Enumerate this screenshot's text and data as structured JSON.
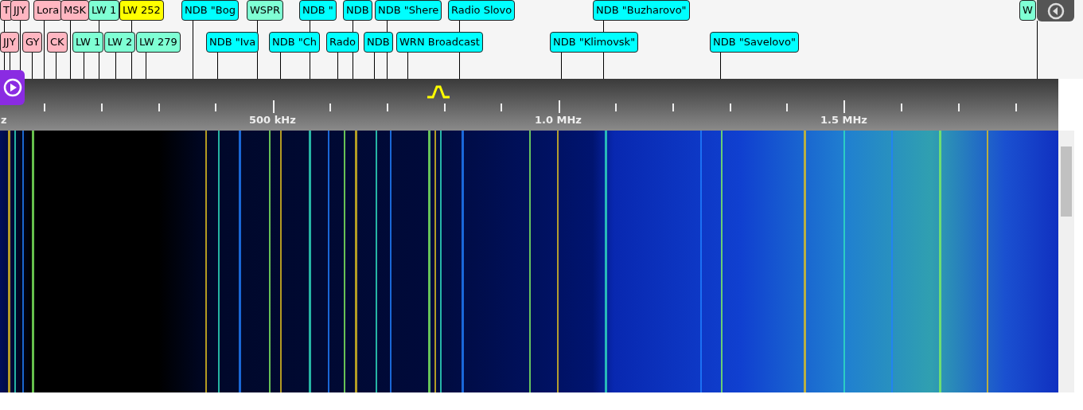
{
  "bookmarks": {
    "upper_row": [
      {
        "label": "T",
        "color": "#ffb6c1"
      },
      {
        "label": "JJY",
        "color": "#ffb6c1"
      },
      {
        "label": "Lora",
        "color": "#ffb6c1"
      },
      {
        "label": "MSK",
        "color": "#ffb6c1"
      },
      {
        "label": "LW 1",
        "color": "#7fffd4"
      },
      {
        "label": "LW 252",
        "color": "#ffff00"
      },
      {
        "label": "NDB \"Bog",
        "color": "#00ffff"
      },
      {
        "label": "WSPR",
        "color": "#7fffd4"
      },
      {
        "label": "NDB \"",
        "color": "#00ffff"
      },
      {
        "label": "NDB",
        "color": "#00ffff"
      },
      {
        "label": "NDB \"Shere",
        "color": "#00ffff"
      },
      {
        "label": "Radio Slovo",
        "color": "#00ffff"
      },
      {
        "label": "NDB \"Buzharovo\"",
        "color": "#00ffff"
      },
      {
        "label": "W",
        "color": "#7fffd4"
      }
    ],
    "lower_row": [
      {
        "label": "JJY",
        "color": "#ffb6c1"
      },
      {
        "label": "GY",
        "color": "#ffb6c1"
      },
      {
        "label": "CK",
        "color": "#ffb6c1"
      },
      {
        "label": "LW 1",
        "color": "#7fffd4"
      },
      {
        "label": "LW 2",
        "color": "#7fffd4"
      },
      {
        "label": "LW 279",
        "color": "#7fffd4"
      },
      {
        "label": "NDB \"Iva",
        "color": "#00ffff"
      },
      {
        "label": "NDB \"Ch",
        "color": "#00ffff"
      },
      {
        "label": "Rado",
        "color": "#00ffff"
      },
      {
        "label": "NDB",
        "color": "#00ffff"
      },
      {
        "label": "WRN Broadcast",
        "color": "#00ffff"
      },
      {
        "label": "NDB \"Klimovsk\"",
        "color": "#00ffff"
      },
      {
        "label": "NDB \"Savelovo\"",
        "color": "#00ffff"
      }
    ]
  },
  "scale": {
    "labels": [
      "z",
      "500 kHz",
      "1.0 MHz",
      "1.5 MHz"
    ]
  }
}
